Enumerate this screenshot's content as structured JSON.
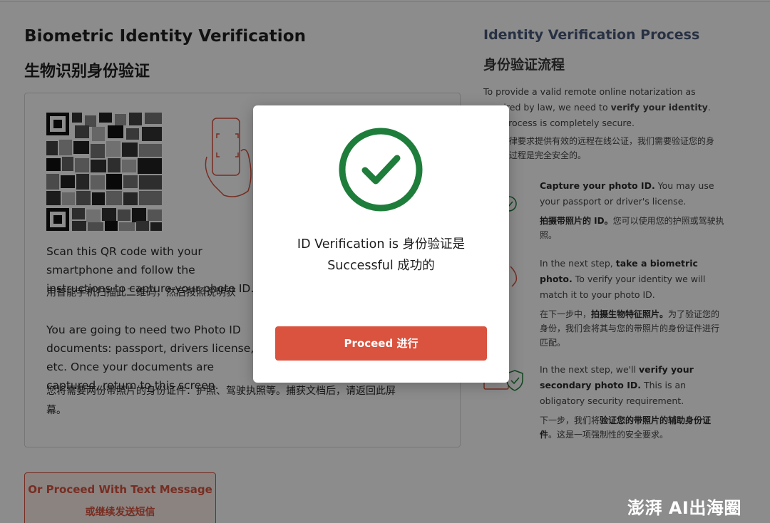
{
  "left": {
    "title": "Biometric Identity Verification",
    "subtitle": "生物识别身份验证",
    "instructions_en": "Scan this QR code with your smartphone and follow the instructions to capture your photo ID.",
    "instructions_cn": "用智能手机扫描此二维码，然后按照说明获",
    "documents_en": "You are going to need two Photo ID documents: passport, drivers license, etc. Once your documents are captured, return to this screen.",
    "documents_cn": "您将需要两份带照片的身份证件：护照、驾驶执照等。捕获文档后，请返回此屏幕。",
    "alt_button_en": "Or Proceed With Text Message",
    "alt_button_cn": "或继续发送短信"
  },
  "right": {
    "title": "Identity Verification Process",
    "subtitle": "身份验证流程",
    "intro_en_1": "To provide a valid remote online notarization as required by law, we need to ",
    "intro_en_bold": "verify your identity",
    "intro_en_2": ". The process is completely secure.",
    "intro_cn": "根据法律要求提供有效的远程在线公证，我们需要验证您的身份。该过程是完全安全的。",
    "steps": [
      {
        "en_bold": "Capture your photo ID.",
        "en_rest": " You may use your passport or driver's license.",
        "cn_bold": "拍摄带照片的 ID。",
        "cn_rest": "您可以使用您的护照或驾驶执照。"
      },
      {
        "en_pre": "In the next step, ",
        "en_bold": "take a biometric photo.",
        "en_rest": " To verify your identity we will match it to your photo ID.",
        "cn_pre": "在下一步中，",
        "cn_bold": "拍摄生物特征照片。",
        "cn_rest": "为了验证您的身份，我们会将其与您的带照片的身份证件进行匹配。"
      },
      {
        "en_pre": "In the next step, we'll ",
        "en_bold": "verify your secondary photo ID.",
        "en_rest": " This is an obligatory security requirement.",
        "cn_pre": "下一步，我们将",
        "cn_bold": "验证您的带照片的辅助身份证件",
        "cn_rest": "。这是一项强制性的安全要求。"
      }
    ]
  },
  "modal": {
    "message_line1": "ID Verification is  身份验证是",
    "message_line2": "Successful   成功的",
    "proceed_label": "Proceed   进行",
    "check_icon": "check-circle-icon"
  },
  "colors": {
    "accent": "#d9533f",
    "success": "#1e7d3a",
    "overlay": "rgba(0,0,0,0.45)"
  },
  "watermark": "澎湃 AI出海圈"
}
